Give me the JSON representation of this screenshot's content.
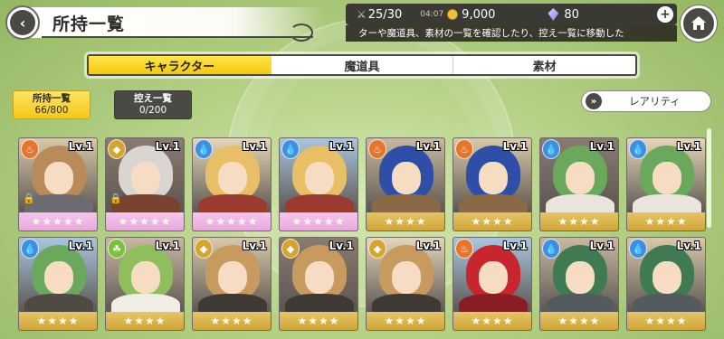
{
  "header": {
    "title": "所持一覧",
    "back_symbol": "‹"
  },
  "resources": {
    "stamina": "25/30",
    "timer": "04:07",
    "coins": "9,000",
    "gems": "80",
    "plus_symbol": "+",
    "info_text": "ターや魔道具、素材の一覧を確認したり、控え一覧に移動した"
  },
  "tabs": [
    {
      "label": "キャラクター",
      "active": true
    },
    {
      "label": "魔道具",
      "active": false
    },
    {
      "label": "素材",
      "active": false
    }
  ],
  "owned_button": {
    "label": "所持一覧",
    "count": "66/800"
  },
  "reserve_button": {
    "label": "控え一覧",
    "count": "0/200"
  },
  "sort": {
    "label": "レアリティ",
    "icon": "chevrons-down-icon"
  },
  "colors": {
    "accent_yellow": "#f3c80e",
    "dark_plate": "#4b4944",
    "rarity_pink": "#e8a9de",
    "rarity_gold": "#cfa43a"
  },
  "cards": [
    {
      "level": "Lv.1",
      "element": "fire",
      "stars": "★★★★★",
      "rarity": "pink",
      "locked": true,
      "hair": "#b98b5a",
      "body": "#6d6a70"
    },
    {
      "level": "Lv.1",
      "element": "earth",
      "stars": "★★★★★",
      "rarity": "pink",
      "locked": true,
      "hair": "#d9d6d2",
      "body": "#7a4330"
    },
    {
      "level": "Lv.1",
      "element": "water",
      "stars": "★★★★★",
      "rarity": "pink",
      "locked": false,
      "hair": "#e8bf66",
      "body": "#9a3a30"
    },
    {
      "level": "Lv.1",
      "element": "water",
      "stars": "★★★★★",
      "rarity": "pink",
      "locked": false,
      "hair": "#e8bf66",
      "body": "#9a3a30"
    },
    {
      "level": "Lv.1",
      "element": "fire",
      "stars": "★★★★",
      "rarity": "gold",
      "locked": false,
      "hair": "#2f4ea8",
      "body": "#8a6a45"
    },
    {
      "level": "Lv.1",
      "element": "fire",
      "stars": "★★★★",
      "rarity": "gold",
      "locked": false,
      "hair": "#2f4ea8",
      "body": "#8a6a45"
    },
    {
      "level": "Lv.1",
      "element": "water",
      "stars": "★★★★",
      "rarity": "gold",
      "locked": false,
      "hair": "#6aa85c",
      "body": "#e9e4dc"
    },
    {
      "level": "Lv.1",
      "element": "water",
      "stars": "★★★★",
      "rarity": "gold",
      "locked": false,
      "hair": "#6aa85c",
      "body": "#e9e4dc"
    },
    {
      "level": "Lv.1",
      "element": "water",
      "stars": "★★★★",
      "rarity": "gold",
      "locked": false,
      "hair": "#6aa85c",
      "body": "#4f4a44"
    },
    {
      "level": "Lv.1",
      "element": "wind",
      "stars": "★★★★",
      "rarity": "gold",
      "locked": false,
      "hair": "#8fbe5c",
      "body": "#f0ede6"
    },
    {
      "level": "Lv.1",
      "element": "earth",
      "stars": "★★★★",
      "rarity": "gold",
      "locked": false,
      "hair": "#c89a5e",
      "body": "#3e3a36"
    },
    {
      "level": "Lv.1",
      "element": "earth",
      "stars": "★★★★",
      "rarity": "gold",
      "locked": false,
      "hair": "#c89a5e",
      "body": "#3e3a36"
    },
    {
      "level": "Lv.1",
      "element": "earth",
      "stars": "★★★★",
      "rarity": "gold",
      "locked": false,
      "hair": "#c89a5e",
      "body": "#3e3a36"
    },
    {
      "level": "Lv.1",
      "element": "fire",
      "stars": "★★★★",
      "rarity": "gold",
      "locked": false,
      "hair": "#c8262c",
      "body": "#8a1e24"
    },
    {
      "level": "Lv.1",
      "element": "water",
      "stars": "★★★★",
      "rarity": "gold",
      "locked": false,
      "hair": "#3f7a52",
      "body": "#555a5e"
    },
    {
      "level": "Lv.1",
      "element": "water",
      "stars": "★★★★",
      "rarity": "gold",
      "locked": false,
      "hair": "#3f7a52",
      "body": "#555a5e"
    }
  ]
}
